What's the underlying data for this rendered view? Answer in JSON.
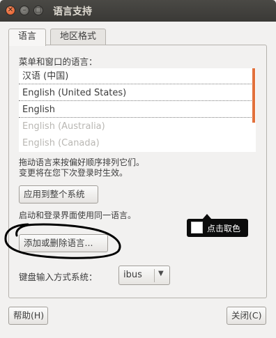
{
  "window": {
    "title": "语言支持"
  },
  "tabs": [
    {
      "label": "语言",
      "active": true
    },
    {
      "label": "地区格式",
      "active": false
    }
  ],
  "language_section": {
    "heading": "菜单和窗口的语言：",
    "languages": [
      {
        "label": "汉语 (中国)",
        "dimmed": false
      },
      {
        "label": "English (United States)",
        "dimmed": false
      },
      {
        "label": "English",
        "dimmed": false
      },
      {
        "label": "English (Australia)",
        "dimmed": true
      },
      {
        "label": "English (Canada)",
        "dimmed": true
      }
    ],
    "hint_line1": "拖动语言来按偏好顺序排列它们。",
    "hint_line2": "变更将在您下次登录时生效。",
    "apply_button": "应用到整个系统",
    "apply_hint": "启动和登录界面使用同一语言。",
    "add_remove_button": "添加或删除语言...",
    "input_method_label": "键盘输入方式系统：",
    "input_method_value": "ibus"
  },
  "color_picker_tooltip": {
    "label": "点击取色",
    "swatch_color": "#ffffff"
  },
  "footer": {
    "help_button": "帮助(H)",
    "close_button": "关闭(C)"
  },
  "colors": {
    "titlebar": "#3c3b37",
    "accent": "#e2713c",
    "annotation_ink": "#000000"
  }
}
